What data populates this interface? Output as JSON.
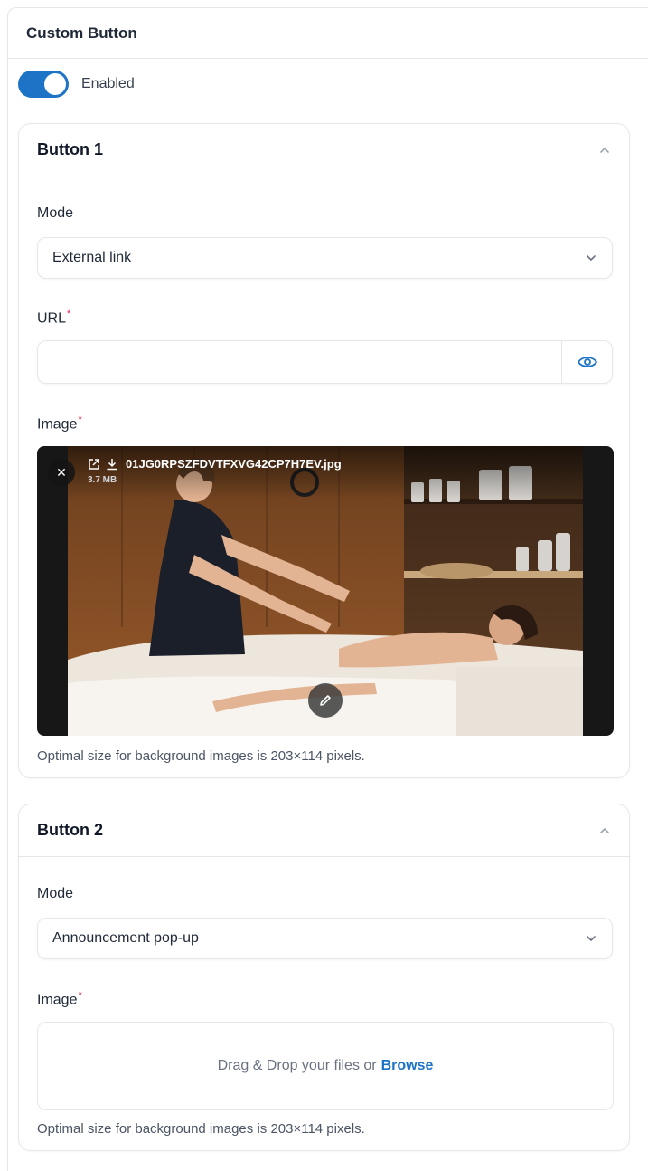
{
  "panel": {
    "title": "Custom Button"
  },
  "toggle": {
    "label": "Enabled",
    "on": true
  },
  "button1": {
    "title": "Button 1",
    "mode_label": "Mode",
    "mode_value": "External link",
    "url_label": "URL",
    "url_value": "",
    "required_mark": "*",
    "image_label": "Image",
    "file_name": "01JG0RPSZFDVTFXVG42CP7H7EV.jpg",
    "file_size": "3.7 MB",
    "hint": "Optimal size for background images is 203×114 pixels."
  },
  "button2": {
    "title": "Button 2",
    "mode_label": "Mode",
    "mode_value": "Announcement pop-up",
    "image_label": "Image",
    "required_mark": "*",
    "drop_text": "Drag & Drop your files or",
    "browse_text": "Browse",
    "hint": "Optimal size for background images is 203×114 pixels."
  },
  "colors": {
    "accent": "#1d74c6",
    "required": "#e11d48"
  }
}
